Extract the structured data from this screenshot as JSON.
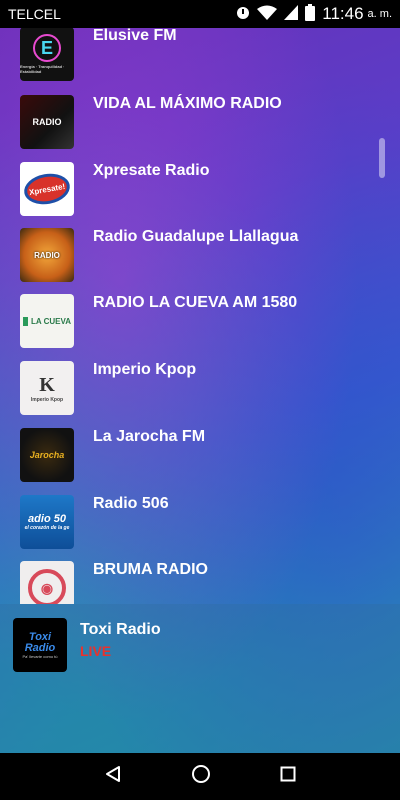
{
  "status": {
    "carrier": "TELCEL",
    "time": "11:46",
    "ampm": "a. m."
  },
  "stations": [
    {
      "name": "Elusive FM",
      "logo_text": "E",
      "logo_caption": "Energía · Tranquilidad · Estabilidad"
    },
    {
      "name": "VIDA AL MÁXIMO RADIO",
      "logo_text": "RADIO"
    },
    {
      "name": "Xpresate Radio",
      "logo_text": "Xpresate!"
    },
    {
      "name": "Radio Guadalupe Llallagua",
      "logo_text": "RADIO"
    },
    {
      "name": "RADIO LA CUEVA AM 1580",
      "logo_text": "LA CUEVA"
    },
    {
      "name": "Imperio Kpop",
      "logo_text": "K",
      "logo_caption": "Imperio Kpop"
    },
    {
      "name": "La Jarocha FM",
      "logo_text": "Jarocha"
    },
    {
      "name": "Radio 506",
      "logo_text": "adio 50",
      "logo_caption": "el corazón de la ge"
    },
    {
      "name": "BRUMA RADIO",
      "logo_text": "◉"
    }
  ],
  "player": {
    "title": "Toxi Radio",
    "status": "LIVE",
    "logo_text": "Toxi Radio",
    "logo_caption": "Pa' llevarte como tú"
  },
  "colors": {
    "live": "#e8322e"
  }
}
